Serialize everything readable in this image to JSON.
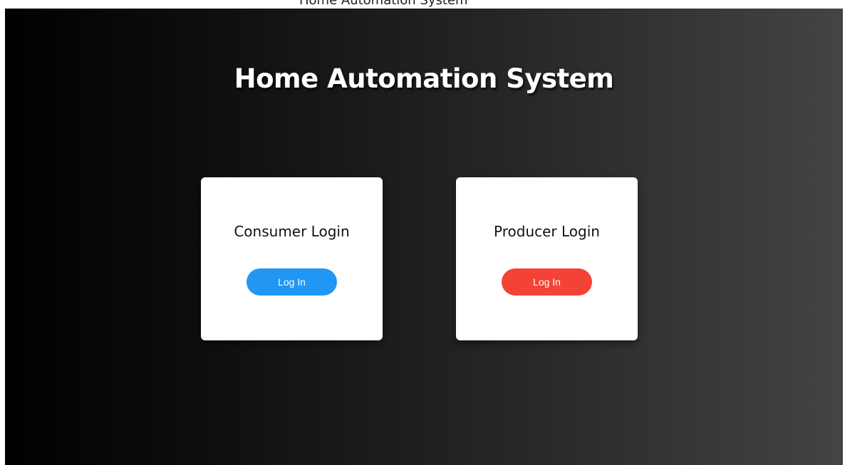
{
  "header": {
    "cropped_text": "Home Automation System"
  },
  "page": {
    "title": "Home Automation System"
  },
  "cards": [
    {
      "title": "Consumer Login",
      "button_label": "Log In",
      "button_color": "#2196f3"
    },
    {
      "title": "Producer Login",
      "button_label": "Log In",
      "button_color": "#f44336"
    }
  ],
  "colors": {
    "background_start": "#000000",
    "background_end": "#444444",
    "card_background": "#ffffff",
    "title_color": "#ffffff"
  }
}
